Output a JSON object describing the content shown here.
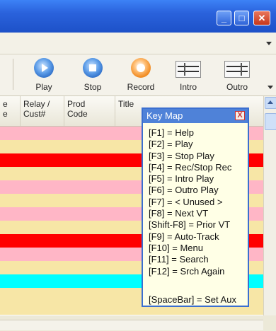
{
  "window": {
    "minimize_glyph": "_",
    "maximize_glyph": "□",
    "close_glyph": "✕"
  },
  "toolbar": {
    "buttons": [
      {
        "label": "Play",
        "icon": "play-icon"
      },
      {
        "label": "Stop",
        "icon": "stop-icon"
      },
      {
        "label": "Record",
        "icon": "record-icon"
      },
      {
        "label": "Intro",
        "icon": "intro-waveform-icon"
      },
      {
        "label": "Outro",
        "icon": "outro-waveform-icon"
      }
    ]
  },
  "grid": {
    "headers": [
      "e\ne",
      "Relay /\nCust#",
      "Prod\nCode",
      "Title"
    ],
    "row_colors": [
      "#ffb6c6",
      "#f7e6a6",
      "#ff0000",
      "#f7e6a6",
      "#ffb6c6",
      "#f7e6a6",
      "#ffb6c6",
      "#f7e6a6",
      "#ff0000",
      "#ffb6c6",
      "#f7e6a6",
      "#00ffff",
      "#f7e6a6",
      "#f7e6a6",
      "#ffffff"
    ]
  },
  "keymap": {
    "title": "Key Map",
    "close_glyph": "X",
    "items": [
      "[F1] = Help",
      "[F2] = Play",
      "[F3] = Stop Play",
      "[F4] = Rec/Stop Rec",
      "[F5] = Intro Play",
      "[F6] = Outro Play",
      "[F7] = < Unused >",
      "[F8] = Next VT",
      "[Shift-F8] = Prior VT",
      "[F9] = Auto-Track",
      "[F10] = Menu",
      "[F11] = Search",
      "[F12] = Srch Again"
    ],
    "aux": "[SpaceBar] = Set Aux"
  },
  "colors": {
    "titlebar": "#2a62dc",
    "keymap_header": "#4f82d8",
    "keymap_bg": "#ffffe6"
  }
}
